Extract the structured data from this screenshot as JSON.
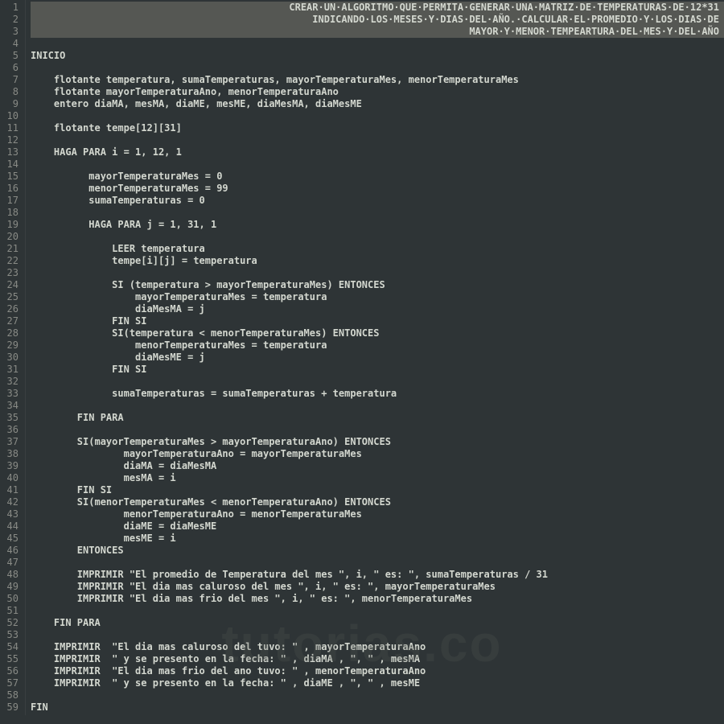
{
  "watermark": "tutorias.co",
  "lines": [
    {
      "n": 1,
      "t": "CREAR·UN·ALGORITMO·QUE·PERMITA·GENERAR·UNA·MATRIZ·DE·TEMPERATURAS·DE·12*31",
      "hl": true,
      "right": true
    },
    {
      "n": 2,
      "t": "INDICANDO·LOS·MESES·Y·DIAS·DEL·AÑO.·CALCULAR·EL·PROMEDIO·Y·LOS·DIAS·DE",
      "hl": true,
      "right": true
    },
    {
      "n": 3,
      "t": "MAYOR·Y·MENOR·TEMPEARTURA·DEL·MES·Y·DEL·AÑO",
      "hl": true,
      "right": true
    },
    {
      "n": 4,
      "t": ""
    },
    {
      "n": 5,
      "t": "INICIO"
    },
    {
      "n": 6,
      "t": ""
    },
    {
      "n": 7,
      "t": "    flotante temperatura, sumaTemperaturas, mayorTemperaturaMes, menorTemperaturaMes"
    },
    {
      "n": 8,
      "t": "    flotante mayorTemperaturaAno, menorTemperaturaAno"
    },
    {
      "n": 9,
      "t": "    entero diaMA, mesMA, diaME, mesME, diaMesMA, diaMesME"
    },
    {
      "n": 10,
      "t": ""
    },
    {
      "n": 11,
      "t": "    flotante tempe[12][31]"
    },
    {
      "n": 12,
      "t": ""
    },
    {
      "n": 13,
      "t": "    HAGA PARA i = 1, 12, 1"
    },
    {
      "n": 14,
      "t": ""
    },
    {
      "n": 15,
      "t": "          mayorTemperaturaMes = 0"
    },
    {
      "n": 16,
      "t": "          menorTemperaturaMes = 99"
    },
    {
      "n": 17,
      "t": "          sumaTemperaturas = 0"
    },
    {
      "n": 18,
      "t": ""
    },
    {
      "n": 19,
      "t": "          HAGA PARA j = 1, 31, 1"
    },
    {
      "n": 20,
      "t": ""
    },
    {
      "n": 21,
      "t": "              LEER temperatura"
    },
    {
      "n": 22,
      "t": "              tempe[i][j] = temperatura"
    },
    {
      "n": 23,
      "t": ""
    },
    {
      "n": 24,
      "t": "              SI (temperatura > mayorTemperaturaMes) ENTONCES"
    },
    {
      "n": 25,
      "t": "                  mayorTemperaturaMes = temperatura"
    },
    {
      "n": 26,
      "t": "                  diaMesMA = j"
    },
    {
      "n": 27,
      "t": "              FIN SI"
    },
    {
      "n": 28,
      "t": "              SI(temperatura < menorTemperaturaMes) ENTONCES"
    },
    {
      "n": 29,
      "t": "                  menorTemperaturaMes = temperatura"
    },
    {
      "n": 30,
      "t": "                  diaMesME = j"
    },
    {
      "n": 31,
      "t": "              FIN SI"
    },
    {
      "n": 32,
      "t": ""
    },
    {
      "n": 33,
      "t": "              sumaTemperaturas = sumaTemperaturas + temperatura"
    },
    {
      "n": 34,
      "t": ""
    },
    {
      "n": 35,
      "t": "        FIN PARA"
    },
    {
      "n": 36,
      "t": ""
    },
    {
      "n": 37,
      "t": "        SI(mayorTemperaturaMes > mayorTemperaturaAno) ENTONCES"
    },
    {
      "n": 38,
      "t": "                mayorTemperaturaAno = mayorTemperaturaMes"
    },
    {
      "n": 39,
      "t": "                diaMA = diaMesMA"
    },
    {
      "n": 40,
      "t": "                mesMA = i"
    },
    {
      "n": 41,
      "t": "        FIN SI"
    },
    {
      "n": 42,
      "t": "        SI(menorTemperaturaMes < menorTemperaturaAno) ENTONCES"
    },
    {
      "n": 43,
      "t": "                menorTemperaturaAno = menorTemperaturaMes"
    },
    {
      "n": 44,
      "t": "                diaME = diaMesME"
    },
    {
      "n": 45,
      "t": "                mesME = i"
    },
    {
      "n": 46,
      "t": "        ENTONCES"
    },
    {
      "n": 47,
      "t": ""
    },
    {
      "n": 48,
      "t": "        IMPRIMIR \"El promedio de Temperatura del mes \", i, \" es: \", sumaTemperaturas / 31"
    },
    {
      "n": 49,
      "t": "        IMPRIMIR \"El dia mas caluroso del mes \", i, \" es: \", mayorTemperaturaMes"
    },
    {
      "n": 50,
      "t": "        IMPRIMIR \"El dia mas frio del mes \", i, \" es: \", menorTemperaturaMes"
    },
    {
      "n": 51,
      "t": ""
    },
    {
      "n": 52,
      "t": "    FIN PARA"
    },
    {
      "n": 53,
      "t": ""
    },
    {
      "n": 54,
      "t": "    IMPRIMIR  \"El dia mas caluroso del tuvo: \" , mayorTemperaturaAno"
    },
    {
      "n": 55,
      "t": "    IMPRIMIR  \" y se presento en la fecha: \" , diaMA , \", \" , mesMA"
    },
    {
      "n": 56,
      "t": "    IMPRIMIR  \"El dia mas frio del ano tuvo: \" , menorTemperaturaAno"
    },
    {
      "n": 57,
      "t": "    IMPRIMIR  \" y se presento en la fecha: \" , diaME , \", \" , mesME"
    },
    {
      "n": 58,
      "t": ""
    },
    {
      "n": 59,
      "t": "FIN"
    }
  ]
}
